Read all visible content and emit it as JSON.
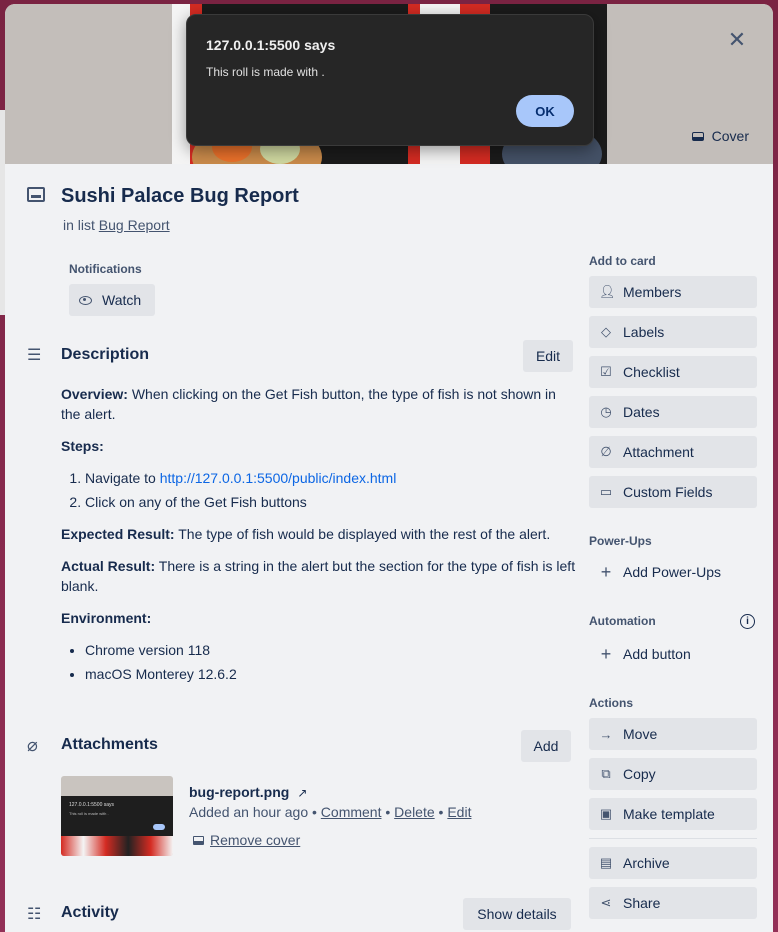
{
  "alert": {
    "title": "127.0.0.1:5500 says",
    "message": "This roll is made with .",
    "ok_label": "OK"
  },
  "cover": {
    "button_label": "Cover"
  },
  "card": {
    "title": "Sushi Palace Bug Report",
    "in_list_prefix": "in list",
    "list_name": "Bug Report"
  },
  "notifications": {
    "label": "Notifications",
    "watch_label": "Watch"
  },
  "description": {
    "title": "Description",
    "edit_label": "Edit",
    "overview_label": "Overview:",
    "overview_text": " When clicking on the Get Fish button, the type of fish is not shown in the alert.",
    "steps_label": "Steps:",
    "step1_prefix": "Navigate to ",
    "step1_link": "http://127.0.0.1:5500/public/index.html",
    "step2": "Click on any of the Get Fish buttons",
    "expected_label": "Expected Result:",
    "expected_text": " The type of fish would be displayed with the rest of the alert.",
    "actual_label": "Actual Result:",
    "actual_text": " There is a string in the alert but the section for the type of fish is left blank.",
    "environment_label": "Environment:",
    "env": [
      "Chrome version 118",
      "macOS Monterey 12.6.2"
    ]
  },
  "attachments": {
    "title": "Attachments",
    "add_label": "Add",
    "thumb_title": "127.0.0.1:5500 says",
    "thumb_msg": "This roll is made with .",
    "file_name": "bug-report.png",
    "arrow": "↗",
    "added": "Added an hour ago",
    "sep": "•",
    "comment": "Comment",
    "delete": "Delete",
    "edit": "Edit",
    "remove_cover": "Remove cover"
  },
  "activity": {
    "title": "Activity",
    "show_details": "Show details"
  },
  "sidebar": {
    "add_to_card": "Add to card",
    "members": "Members",
    "labels": "Labels",
    "checklist": "Checklist",
    "dates": "Dates",
    "attachment": "Attachment",
    "custom_fields": "Custom Fields",
    "power_ups": "Power-Ups",
    "add_power_ups": "Add Power-Ups",
    "automation": "Automation",
    "add_button": "Add button",
    "actions": "Actions",
    "move": "Move",
    "copy": "Copy",
    "make_template": "Make template",
    "archive": "Archive",
    "share": "Share"
  }
}
